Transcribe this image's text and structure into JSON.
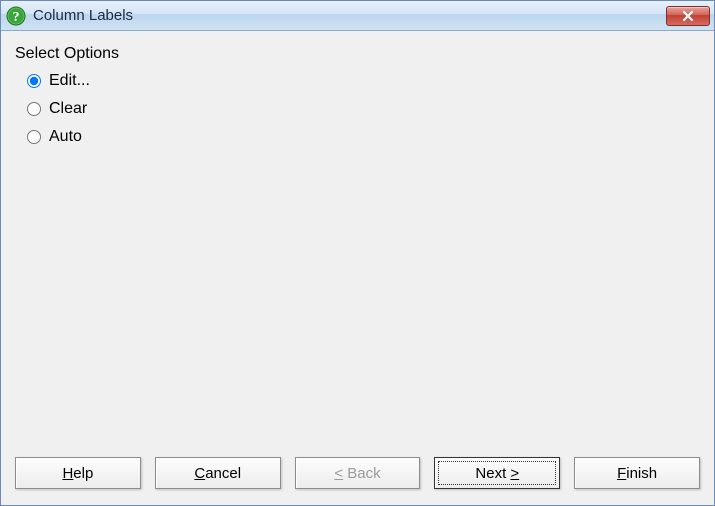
{
  "window": {
    "title": "Column Labels"
  },
  "content": {
    "section_label": "Select Options",
    "options": {
      "edit": {
        "label": "Edit...",
        "checked": true
      },
      "clear": {
        "label": "Clear",
        "checked": false
      },
      "auto": {
        "label": "Auto",
        "checked": false
      }
    }
  },
  "buttons": {
    "help": {
      "pre": "",
      "mn": "H",
      "post": "elp"
    },
    "cancel": {
      "pre": "",
      "mn": "C",
      "post": "ancel"
    },
    "back": {
      "pre": "",
      "mn": "<",
      "post": " Back"
    },
    "next": {
      "pre": "Next ",
      "mn": ">",
      "post": ""
    },
    "finish": {
      "pre": "",
      "mn": "F",
      "post": "inish"
    }
  }
}
